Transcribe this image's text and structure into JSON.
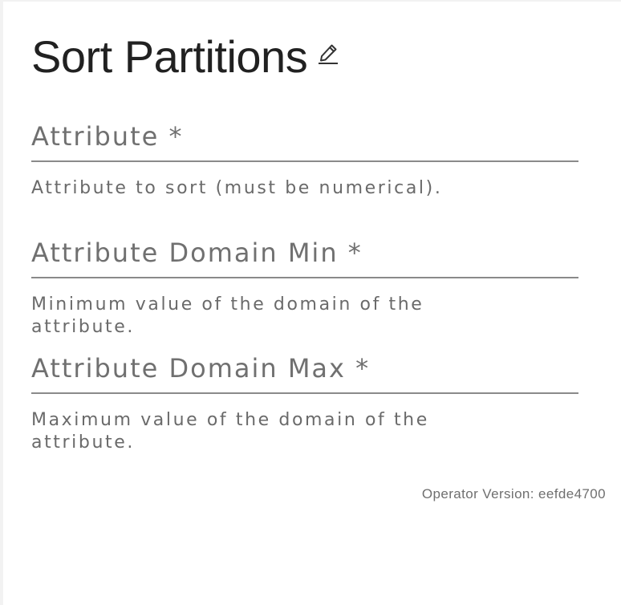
{
  "title": "Sort Partitions",
  "title_edit_icon": "pencil-edit-icon",
  "fields": [
    {
      "label": "Attribute *",
      "value": "",
      "help": "Attribute to sort (must be numerical)."
    },
    {
      "label": "Attribute Domain Min *",
      "value": "",
      "help": "Minimum value of the domain of the attribute."
    },
    {
      "label": "Attribute Domain Max *",
      "value": "",
      "help": "Maximum value of the domain of the attribute."
    }
  ],
  "version_text": "Operator Version: eefde4700",
  "colors": {
    "title": "#212121",
    "label": "#707070",
    "underline": "#8a8a8a",
    "help": "#6a6a6a",
    "background": "#ffffff"
  }
}
